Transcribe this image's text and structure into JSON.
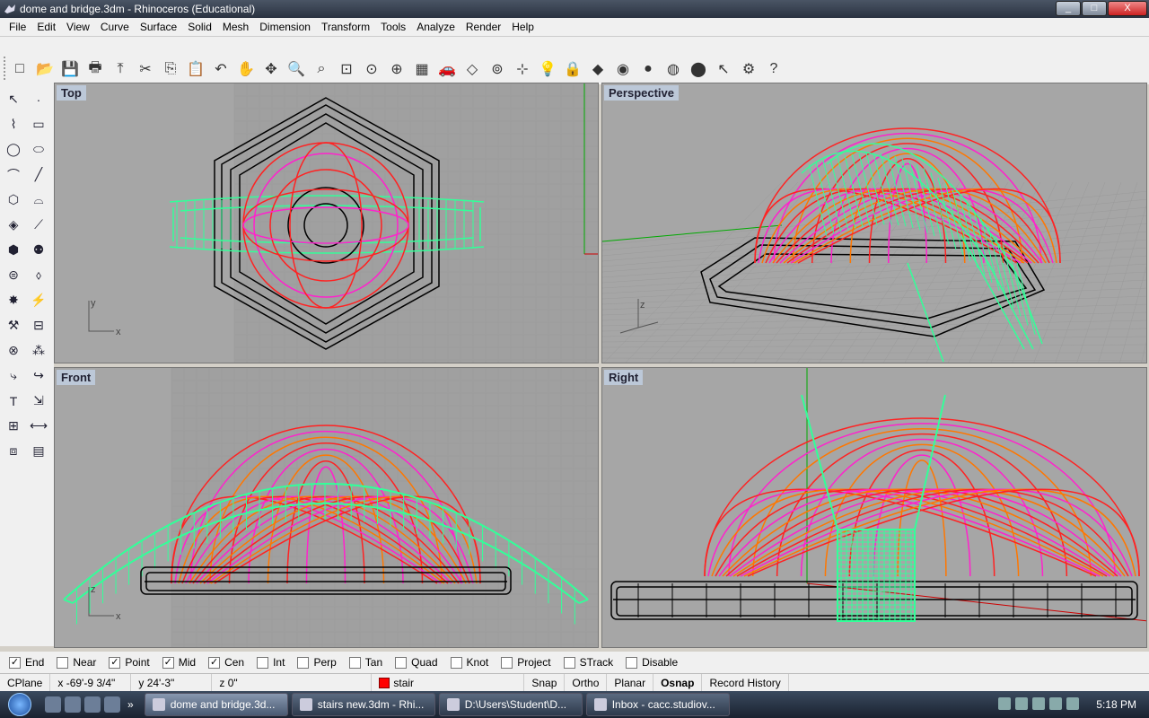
{
  "window": {
    "title": "dome and bridge.3dm - Rhinoceros (Educational)",
    "minimize_label": "_",
    "maximize_label": "□",
    "close_label": "X"
  },
  "menu": [
    "File",
    "Edit",
    "View",
    "Curve",
    "Surface",
    "Solid",
    "Mesh",
    "Dimension",
    "Transform",
    "Tools",
    "Analyze",
    "Render",
    "Help"
  ],
  "toolbar_icons": [
    "new-icon",
    "open-icon",
    "save-icon",
    "print-icon",
    "import-icon",
    "cut-icon",
    "copy-icon",
    "paste-icon",
    "undo-icon",
    "pan-hand-icon",
    "rotate-view-icon",
    "zoom-icon",
    "zoom-window-icon",
    "zoom-extents-icon",
    "zoom-selected-icon",
    "zoom-all-icon",
    "four-viewports-icon",
    "car-icon",
    "cplane-icon",
    "osnap-icon",
    "grid-snap-icon",
    "light-bulb-icon",
    "lock-icon",
    "material-icon",
    "color-wheel-icon",
    "sphere-icon",
    "mesh-sphere-icon",
    "render-sphere-icon",
    "select-icon",
    "settings-icon",
    "help-icon"
  ],
  "left_tools": {
    "col1": [
      "arrow-select-icon",
      "polyline-icon",
      "circle-icon",
      "curve-icon",
      "polygon-icon",
      "surface-icon",
      "box-icon",
      "cylinder-icon",
      "gear-settings-icon",
      "point-edit-icon",
      "boolean-icon",
      "fillet-icon",
      "text-icon",
      "array-icon",
      "solid-box-icon"
    ],
    "col2": [
      "point-icon",
      "rectangle-icon",
      "ellipse-icon",
      "line-icon",
      "arc-icon",
      "loft-icon",
      "sphere-tool-icon",
      "plane-tool-icon",
      "explode-icon",
      "split-icon",
      "group-icon",
      "extend-icon",
      "move-icon",
      "dimension-icon",
      "hatch-icon"
    ]
  },
  "viewports": {
    "top": {
      "label": "Top"
    },
    "perspective": {
      "label": "Perspective"
    },
    "front": {
      "label": "Front"
    },
    "right": {
      "label": "Right"
    }
  },
  "axes": {
    "x": "x",
    "y": "y",
    "z": "z"
  },
  "osnap": [
    {
      "label": "End",
      "checked": true
    },
    {
      "label": "Near",
      "checked": false
    },
    {
      "label": "Point",
      "checked": true
    },
    {
      "label": "Mid",
      "checked": true
    },
    {
      "label": "Cen",
      "checked": true
    },
    {
      "label": "Int",
      "checked": false
    },
    {
      "label": "Perp",
      "checked": false
    },
    {
      "label": "Tan",
      "checked": false
    },
    {
      "label": "Quad",
      "checked": false
    },
    {
      "label": "Knot",
      "checked": false
    },
    {
      "label": "Project",
      "checked": false
    },
    {
      "label": "STrack",
      "checked": false
    },
    {
      "label": "Disable",
      "checked": false
    }
  ],
  "status": {
    "cplane": "CPlane",
    "x": "x -69'-9 3/4\"",
    "y": "y 24'-3\"",
    "z": "z 0\"",
    "layer": "stair",
    "layer_color": "#ff0000",
    "snap": "Snap",
    "ortho": "Ortho",
    "planar": "Planar",
    "osnap": "Osnap",
    "record": "Record History"
  },
  "taskbar": {
    "more": "»",
    "tasks": [
      {
        "label": "dome and bridge.3d...",
        "active": true
      },
      {
        "label": "stairs new.3dm - Rhi...",
        "active": false
      },
      {
        "label": "D:\\Users\\Student\\D...",
        "active": false
      },
      {
        "label": "Inbox - cacc.studiov...",
        "active": false
      }
    ],
    "clock": "5:18 PM"
  },
  "colors": {
    "bridge": "#33ff99",
    "dome_red": "#ff2222",
    "dome_magenta": "#ff22cc",
    "dome_orange": "#ff7700",
    "base": "#000000",
    "viewport_bg": "#a6a6a6",
    "grid": "#9a9a9a"
  }
}
